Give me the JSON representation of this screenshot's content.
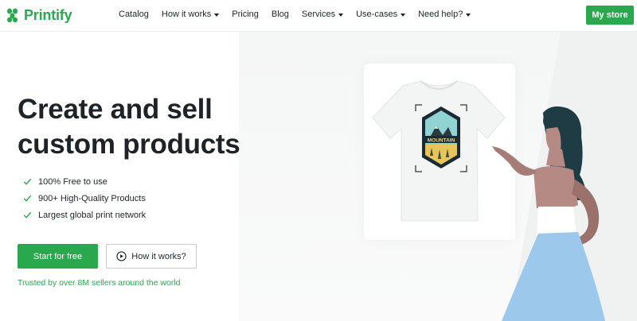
{
  "header": {
    "logo_text": "Printify",
    "nav": [
      {
        "label": "Catalog",
        "dropdown": false
      },
      {
        "label": "How it works",
        "dropdown": true
      },
      {
        "label": "Pricing",
        "dropdown": false
      },
      {
        "label": "Blog",
        "dropdown": false
      },
      {
        "label": "Services",
        "dropdown": true
      },
      {
        "label": "Use-cases",
        "dropdown": true
      },
      {
        "label": "Need help?",
        "dropdown": true
      }
    ],
    "cta_label": "My store"
  },
  "hero": {
    "title_line1": "Create and sell",
    "title_line2": "custom products",
    "features": [
      "100% Free to use",
      "900+ High-Quality Products",
      "Largest global print network"
    ],
    "start_button": "Start for free",
    "how_button": "How it works?",
    "trusted": "Trusted by over 8M sellers around the world"
  },
  "illustration": {
    "badge_text": "MOUNTAIN"
  },
  "colors": {
    "brand_green": "#29a84e",
    "text_dark": "#1f2328"
  },
  "icons": {
    "logo": "printify-leaf-icon",
    "check": "check-icon",
    "play": "play-circle-icon",
    "caret": "chevron-down-icon"
  }
}
